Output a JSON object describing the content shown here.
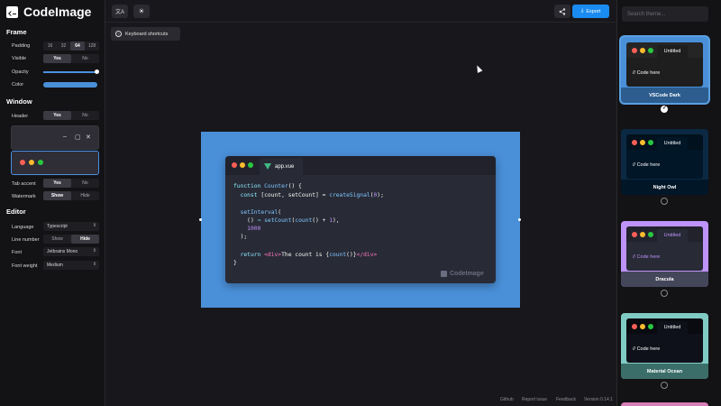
{
  "app": {
    "name": "CodeImage"
  },
  "sidebar": {
    "frame": {
      "title": "Frame",
      "padding": {
        "label": "Padding",
        "options": [
          "16",
          "32",
          "64",
          "128"
        ],
        "selected": "64"
      },
      "visible": {
        "label": "Visible",
        "options": [
          "Yes",
          "No"
        ],
        "selected": "Yes"
      },
      "opacity": {
        "label": "Opacity",
        "value": 1
      },
      "color": {
        "label": "Color",
        "value": "#4a90d9"
      }
    },
    "window": {
      "title": "Window",
      "header": {
        "label": "Header",
        "options": [
          "Yes",
          "No"
        ],
        "selected": "Yes"
      },
      "tab_accent": {
        "label": "Tab accent",
        "options": [
          "Yes",
          "No"
        ],
        "selected": "Yes"
      },
      "watermark": {
        "label": "Watermark",
        "options": [
          "Show",
          "Hide"
        ],
        "selected": "Show"
      }
    },
    "editor": {
      "title": "Editor",
      "language": {
        "label": "Language",
        "value": "Typescript"
      },
      "line_number": {
        "label": "Line number",
        "options": [
          "Show",
          "Hide"
        ],
        "selected": "Hide"
      },
      "font": {
        "label": "Font",
        "value": "Jetbrains Mono"
      },
      "font_weight": {
        "label": "Font weight",
        "value": "Medium"
      }
    }
  },
  "toolbar": {
    "translate_icon": "文A",
    "theme_icon": "☀",
    "share_icon": "share-icon",
    "export_label": "Export",
    "shortcuts_label": "Keyboard shortcuts"
  },
  "editor_window": {
    "tab_name": "app.vue",
    "watermark": "CodeImage"
  },
  "footer": {
    "links": [
      "Github",
      "Report issue",
      "Feedback"
    ],
    "version": "Version 0.14.1"
  },
  "themes": {
    "search_placeholder": "Search theme...",
    "items": [
      {
        "name": "VSCode Dark",
        "tab": "Untitled",
        "code": "// Code here",
        "selected": true
      },
      {
        "name": "Night Owl",
        "tab": "Untitled",
        "code": "// Code here",
        "selected": false
      },
      {
        "name": "Dracula",
        "tab": "Untitled",
        "code": "// Code here",
        "selected": false
      },
      {
        "name": "Material Ocean",
        "tab": "Untitled",
        "code": "// Code here",
        "selected": false
      }
    ]
  },
  "colors": {
    "accent": "#1a8bf0",
    "frame_bg": "#4a90d9",
    "window_bg": "#282a36"
  }
}
